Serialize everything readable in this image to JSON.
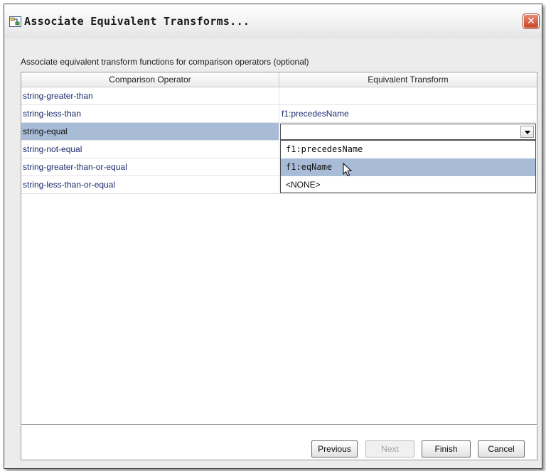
{
  "window": {
    "title": "Associate Equivalent Transforms...",
    "close_icon": "close-icon"
  },
  "description": "Associate equivalent transform functions for comparison operators (optional)",
  "table": {
    "columns": [
      "Comparison Operator",
      "Equivalent Transform"
    ],
    "rows": [
      {
        "operator": "string-greater-than",
        "transform": ""
      },
      {
        "operator": "string-less-than",
        "transform": "f1:precedesName"
      },
      {
        "operator": "string-equal",
        "transform": ""
      },
      {
        "operator": "string-not-equal",
        "transform": ""
      },
      {
        "operator": "string-greater-than-or-equal",
        "transform": ""
      },
      {
        "operator": "string-less-than-or-equal",
        "transform": ""
      }
    ],
    "selected_row": "string-equal"
  },
  "dropdown": {
    "current_value": "",
    "options": [
      "f1:precedesName",
      "f1:eqName",
      "<NONE>"
    ],
    "hovered_option": "f1:eqName"
  },
  "buttons": {
    "previous": "Previous",
    "next": "Next",
    "finish": "Finish",
    "cancel": "Cancel"
  },
  "colors": {
    "selection": "#a8bcd8",
    "operator_text": "#1c2a6b",
    "close_button": "#c84526"
  }
}
